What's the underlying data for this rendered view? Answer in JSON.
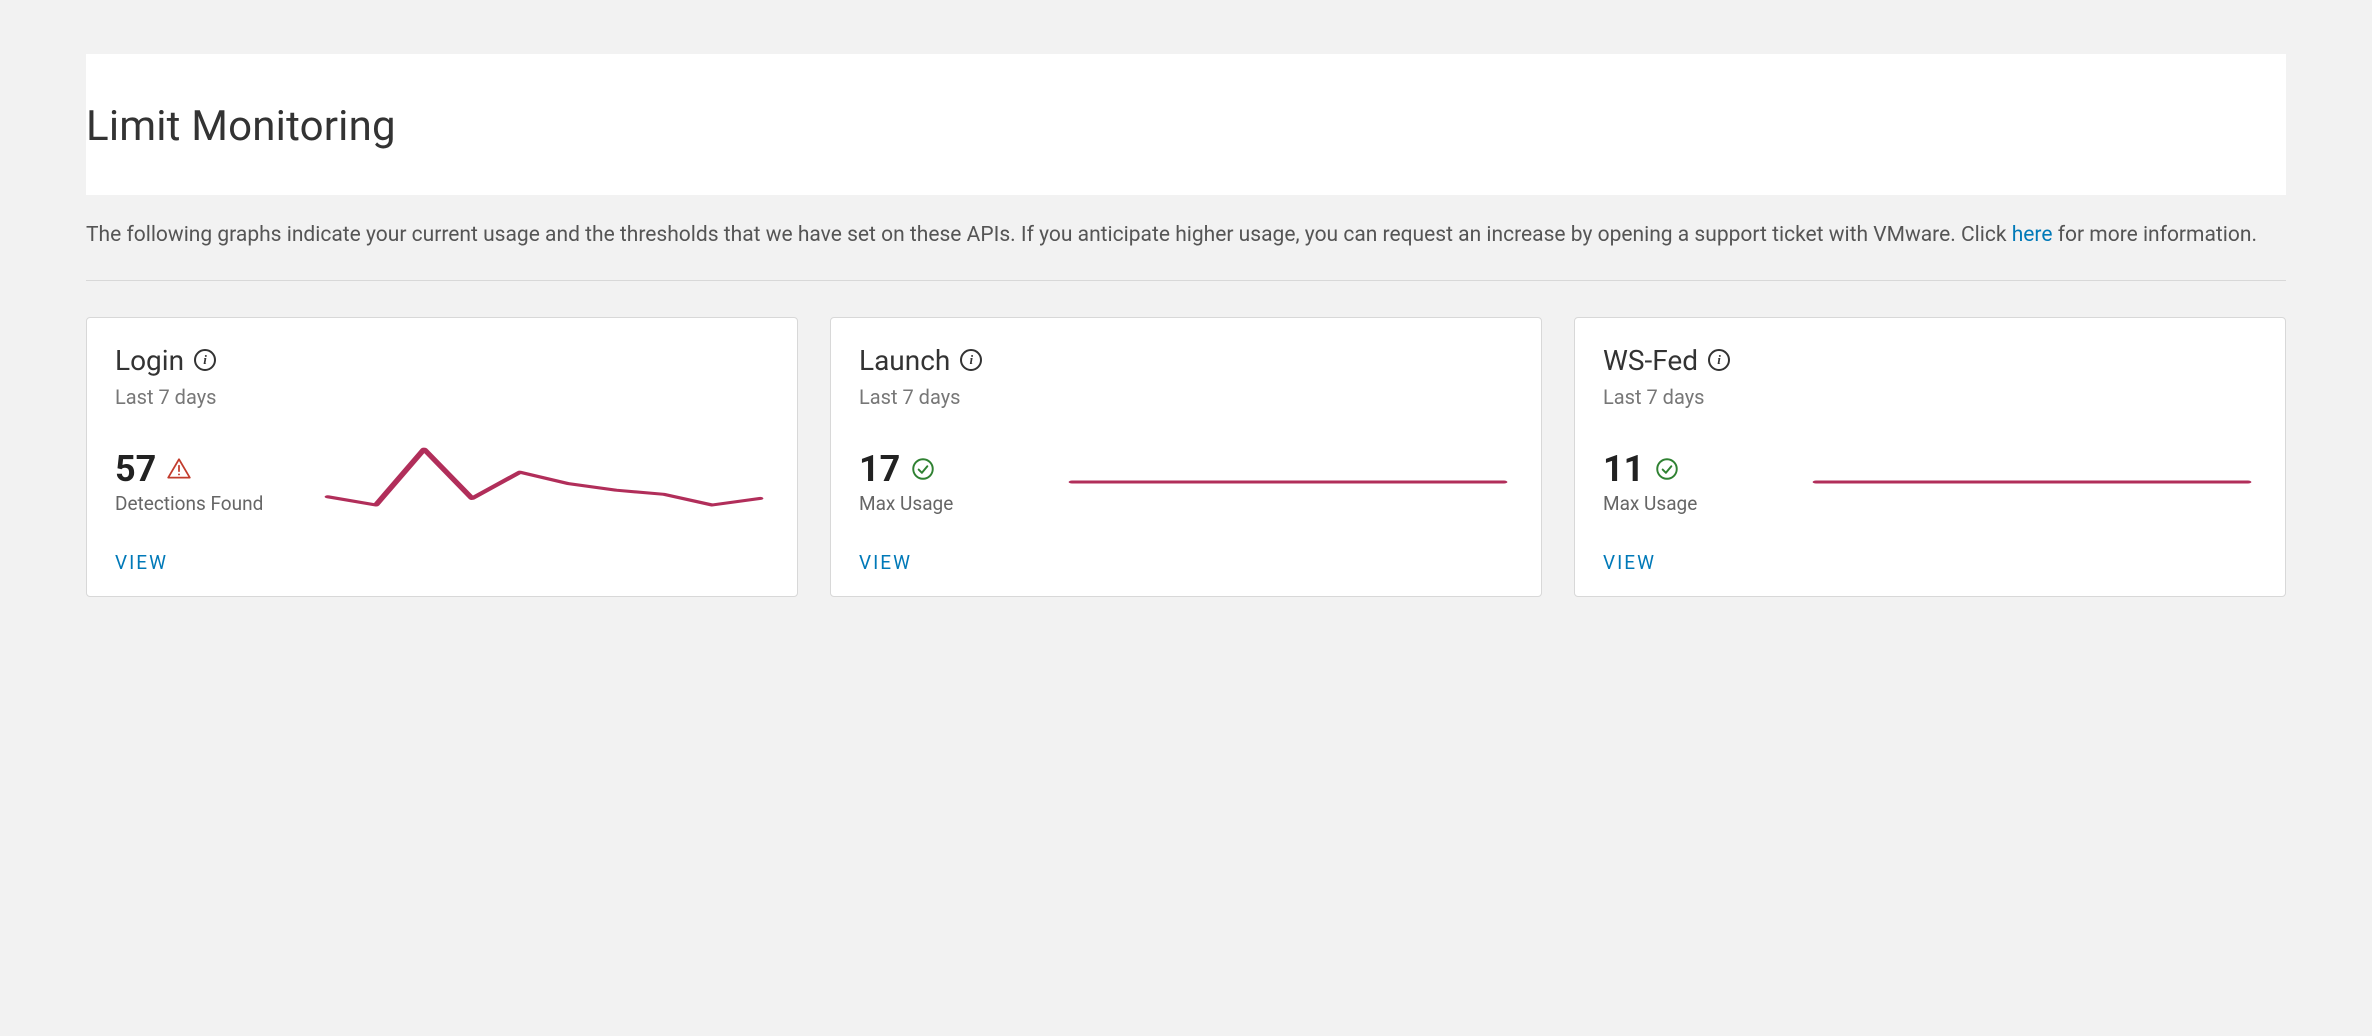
{
  "page": {
    "title": "Limit Monitoring",
    "description_pre": "The following graphs indicate your current usage and the thresholds that we have set on these APIs. If you anticipate higher usage, you can request an increase by opening a support ticket with VMware. Click ",
    "description_link": "here",
    "description_post": " for more information."
  },
  "cards": [
    {
      "title": "Login",
      "subtitle": "Last 7 days",
      "metric_value": "57",
      "metric_label": "Detections Found",
      "status": "alert",
      "view_label": "VIEW",
      "spark_values": [
        32,
        22,
        90,
        30,
        62,
        48,
        40,
        35,
        22,
        30
      ]
    },
    {
      "title": "Launch",
      "subtitle": "Last 7 days",
      "metric_value": "17",
      "metric_label": "Max Usage",
      "status": "ok",
      "view_label": "VIEW",
      "spark_values": [
        50,
        50,
        50,
        50,
        50,
        50,
        50,
        50,
        50,
        50
      ]
    },
    {
      "title": "WS-Fed",
      "subtitle": "Last 7 days",
      "metric_value": "11",
      "metric_label": "Max Usage",
      "status": "ok",
      "view_label": "VIEW",
      "spark_values": [
        50,
        50,
        50,
        50,
        50,
        50,
        50,
        50,
        50,
        50
      ]
    }
  ],
  "colors": {
    "spark": "#b12e5a",
    "alert": "#c23c2d",
    "ok": "#2f8132",
    "link": "#0079b8"
  },
  "chart_data": [
    {
      "type": "line",
      "title": "Login — Last 7 days",
      "x": [
        1,
        2,
        3,
        4,
        5,
        6,
        7,
        8,
        9,
        10
      ],
      "values": [
        32,
        22,
        90,
        30,
        62,
        48,
        40,
        35,
        22,
        30
      ],
      "ylim": [
        0,
        100
      ]
    },
    {
      "type": "line",
      "title": "Launch — Last 7 days",
      "x": [
        1,
        2,
        3,
        4,
        5,
        6,
        7,
        8,
        9,
        10
      ],
      "values": [
        50,
        50,
        50,
        50,
        50,
        50,
        50,
        50,
        50,
        50
      ],
      "ylim": [
        0,
        100
      ]
    },
    {
      "type": "line",
      "title": "WS-Fed — Last 7 days",
      "x": [
        1,
        2,
        3,
        4,
        5,
        6,
        7,
        8,
        9,
        10
      ],
      "values": [
        50,
        50,
        50,
        50,
        50,
        50,
        50,
        50,
        50,
        50
      ],
      "ylim": [
        0,
        100
      ]
    }
  ]
}
